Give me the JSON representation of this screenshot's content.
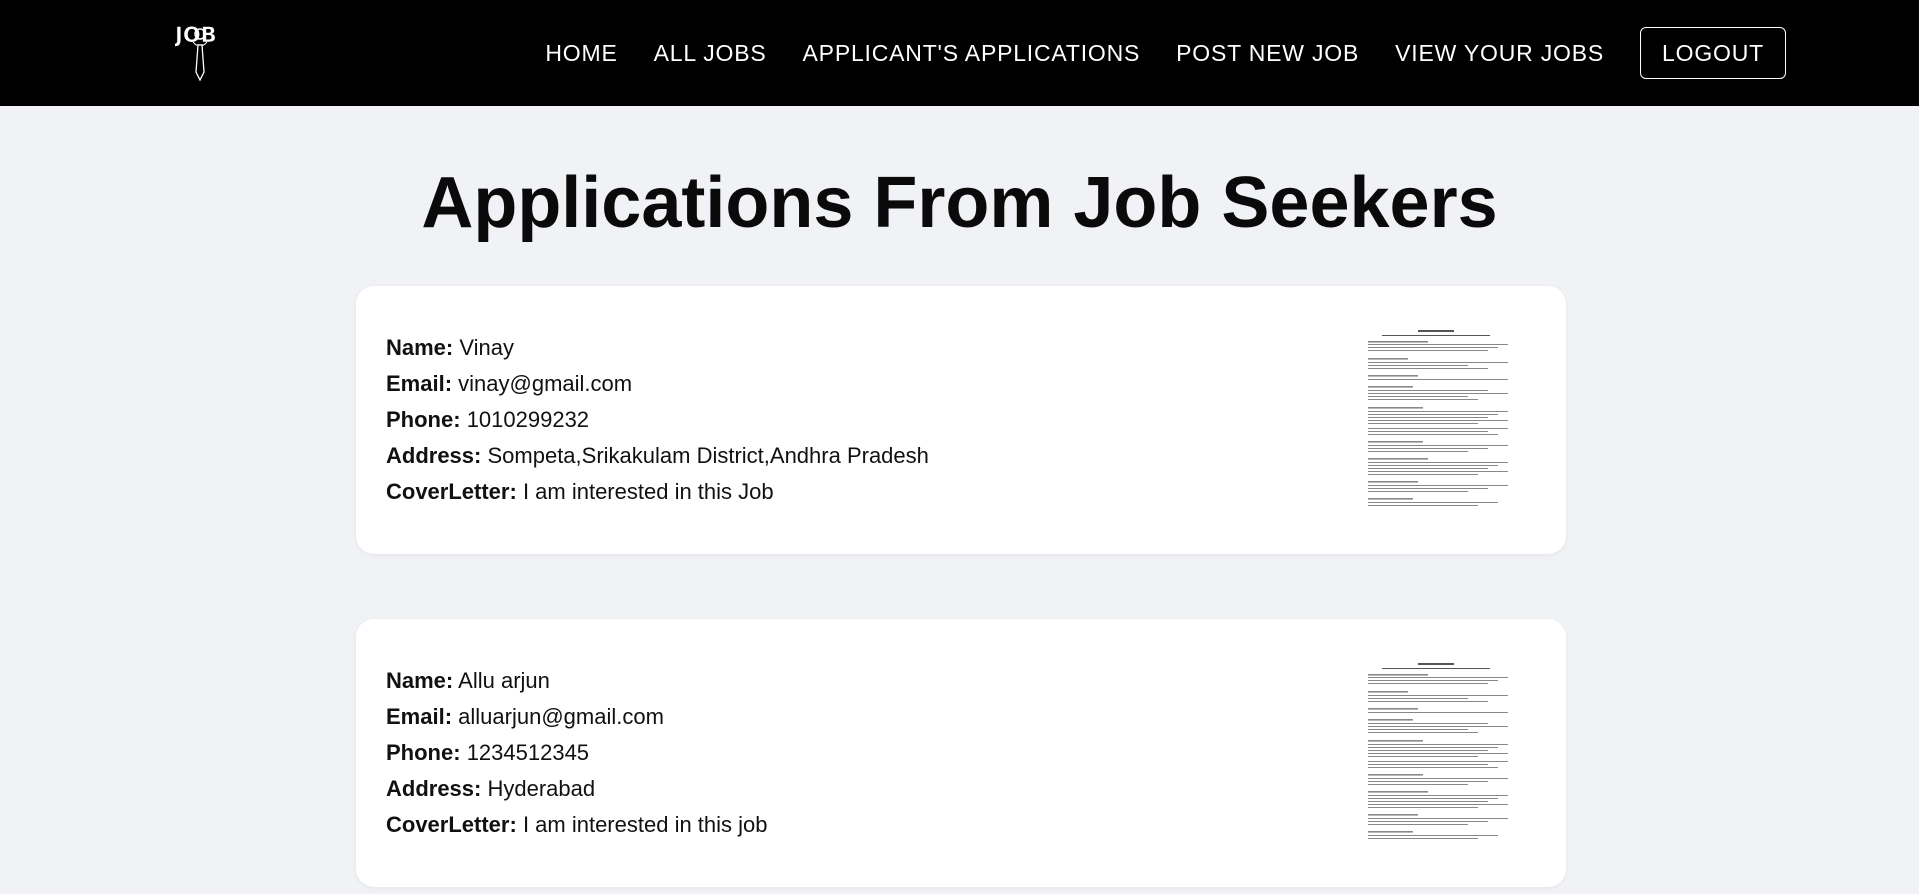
{
  "navbar": {
    "logo_text": "JOB",
    "links": [
      "HOME",
      "ALL JOBS",
      "APPLICANT'S APPLICATIONS",
      "POST NEW JOB",
      "VIEW YOUR JOBS"
    ],
    "logout_label": "LOGOUT"
  },
  "page": {
    "title": "Applications From Job Seekers"
  },
  "labels": {
    "name": "Name:",
    "email": "Email:",
    "phone": "Phone:",
    "address": "Address:",
    "cover_letter": "CoverLetter:"
  },
  "applications": [
    {
      "name": "Vinay",
      "email": "vinay@gmail.com",
      "phone": "1010299232",
      "address": "Sompeta,Srikakulam District,Andhra Pradesh",
      "cover_letter": "I am interested in this Job",
      "resume_icon": "resume-thumbnail"
    },
    {
      "name": "Allu arjun",
      "email": "alluarjun@gmail.com",
      "phone": "1234512345",
      "address": "Hyderabad",
      "cover_letter": "I am interested in this job",
      "resume_icon": "resume-thumbnail"
    }
  ],
  "colors": {
    "navbar_bg": "#000000",
    "page_bg": "#f0f2f5",
    "card_bg": "#ffffff"
  }
}
